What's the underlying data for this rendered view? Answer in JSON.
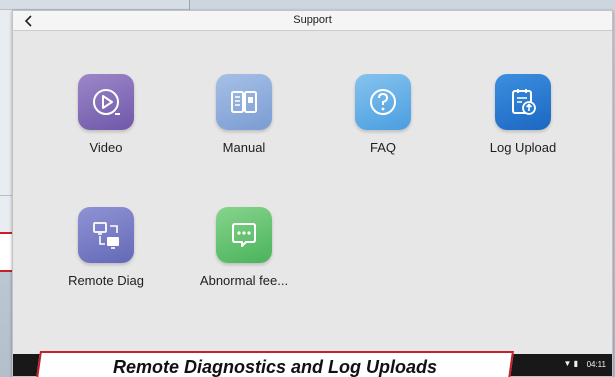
{
  "window": {
    "title": "Support"
  },
  "tiles": [
    {
      "label": "Video",
      "icon": "video-icon",
      "color": "#7a63b3"
    },
    {
      "label": "Manual",
      "icon": "manual-icon",
      "color": "#8aa9dc"
    },
    {
      "label": "FAQ",
      "icon": "faq-icon",
      "color": "#5aaee6"
    },
    {
      "label": "Log Upload",
      "icon": "log-upload-icon",
      "color": "#2a7bd3"
    },
    {
      "label": "Remote Diag",
      "icon": "remote-diag-icon",
      "color": "#6b70bd"
    },
    {
      "label": "Abnormal fee...",
      "icon": "feedback-icon",
      "color": "#5bbf67"
    }
  ],
  "statusbar": {
    "time": "04:11",
    "icons": "▼ ▮"
  },
  "caption": {
    "text": "Remote Diagnostics and Log Uploads"
  }
}
